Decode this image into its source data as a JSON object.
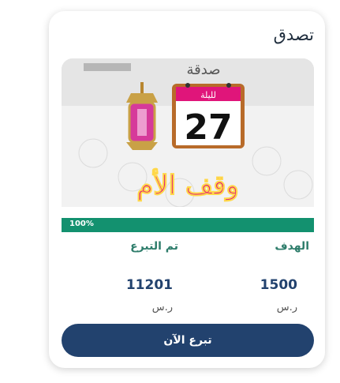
{
  "card": {
    "title": "تصدق",
    "banner": {
      "heading": "صدقة",
      "calendar_label": "لليلة",
      "calendar_number": "27",
      "calligraphy": "وقف الأم"
    },
    "progress": {
      "value_percent": 100,
      "label": "100%"
    },
    "goal": {
      "label": "الهدف",
      "value": "1500",
      "unit": "ر.س"
    },
    "donated": {
      "label": "تم التبرع",
      "value": "11201",
      "unit": "ر.س"
    },
    "donate_button_label": "تبرع الآن"
  },
  "colors": {
    "accent_green": "#13916f",
    "navy": "#22426e",
    "calendar_pink": "#e0157a"
  }
}
